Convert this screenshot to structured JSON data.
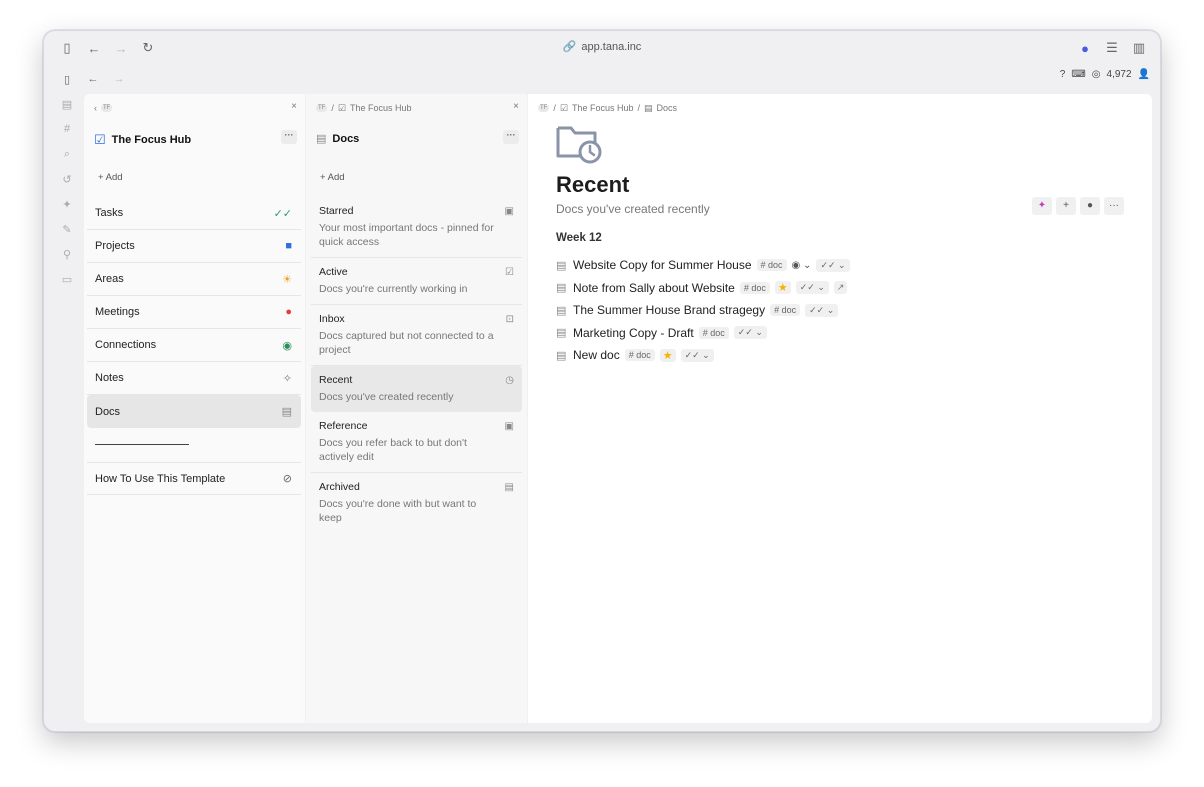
{
  "browser": {
    "url": "app.tana.inc"
  },
  "app_bar": {
    "credits": "4,972"
  },
  "panel1": {
    "badge": "TF",
    "title": "The Focus Hub",
    "more": "···",
    "add": "Add",
    "items": [
      {
        "label": "Tasks",
        "icon": "✓✓",
        "color": "#2e9c6a"
      },
      {
        "label": "Projects",
        "icon": "■",
        "color": "#2f6fe0"
      },
      {
        "label": "Areas",
        "icon": "☀",
        "color": "#f0a020"
      },
      {
        "label": "Meetings",
        "icon": "●",
        "color": "#e04040"
      },
      {
        "label": "Connections",
        "icon": "◉",
        "color": "#2e8c5a"
      },
      {
        "label": "Notes",
        "icon": "✧",
        "color": "#777777"
      },
      {
        "label": "Docs",
        "icon": "▤",
        "color": "#888888"
      }
    ],
    "howto": "How To Use This Template"
  },
  "panel2": {
    "badge": "TF",
    "crumb": "The Focus Hub",
    "title": "Docs",
    "more": "···",
    "add": "Add",
    "items": [
      {
        "title": "Starred",
        "desc": "Your most important docs - pinned for quick access"
      },
      {
        "title": "Active",
        "desc": "Docs you're currently working in"
      },
      {
        "title": "Inbox",
        "desc": "Docs captured but not connected to a project"
      },
      {
        "title": "Recent",
        "desc": "Docs you've created recently"
      },
      {
        "title": "Reference",
        "desc": "Docs you refer back to but don't actively edit"
      },
      {
        "title": "Archived",
        "desc": "Docs you're done with but want to keep"
      }
    ]
  },
  "panel3": {
    "badge": "TF",
    "crumb1": "The Focus Hub",
    "crumb2": "Docs",
    "title": "Recent",
    "subtitle": "Docs you've created recently",
    "week": "Week 12",
    "rows": [
      {
        "title": "Website Copy for Summer House",
        "tag": "# doc"
      },
      {
        "title": "Note from Sally about Website",
        "tag": "# doc"
      },
      {
        "title": "The Summer House Brand stragegy",
        "tag": "# doc"
      },
      {
        "title": "Marketing Copy - Draft",
        "tag": "# doc"
      },
      {
        "title": "New doc",
        "tag": "# doc"
      }
    ]
  }
}
